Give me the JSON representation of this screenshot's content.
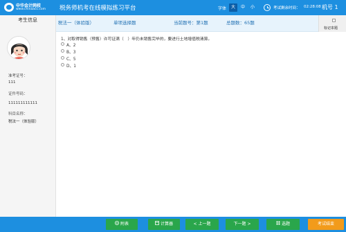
{
  "header": {
    "logo_cn": "中华会计网校",
    "logo_url": "www.chinaacc.com",
    "platform_title": "税务师机考在线模拟练习平台",
    "font_label": "字体",
    "font_big": "大",
    "font_mid": "中",
    "font_small": "小",
    "timer_label": "考试剩余时间：",
    "timer_value": "02:28:08",
    "machine_label": "机号 1"
  },
  "sidebar": {
    "title": "考生信息",
    "ticket_label": "准考证号：",
    "ticket_value": "111",
    "id_label": "证件号码：",
    "id_value": "111111111111",
    "subject_label": "科目名称：",
    "subject_value": "税法一（体验版）"
  },
  "infobar": {
    "subject": "税法一（体验版）",
    "question_type": "单项选择题",
    "current_question": "当前题号：第1题",
    "total_questions": "总题数：65题",
    "mark_label": "标记本题"
  },
  "question": {
    "text": "1、对取得销售（预售）许可证满（　）年仍未销售完毕的，要进行土地增值税清算。",
    "options": [
      {
        "label": "A、2"
      },
      {
        "label": "B、3"
      },
      {
        "label": "C、5"
      },
      {
        "label": "D、1"
      }
    ]
  },
  "toolbar": {
    "table_label": "附表",
    "calculator_label": "计算器",
    "prev_label": "< 上一题",
    "next_label": "下一题 >",
    "select_label": "选题",
    "submit_label": "考试结束"
  },
  "colors": {
    "primary_blue": "#1d8fe0",
    "button_green": "#2aa64b",
    "submit_orange": "#f29b1b"
  }
}
